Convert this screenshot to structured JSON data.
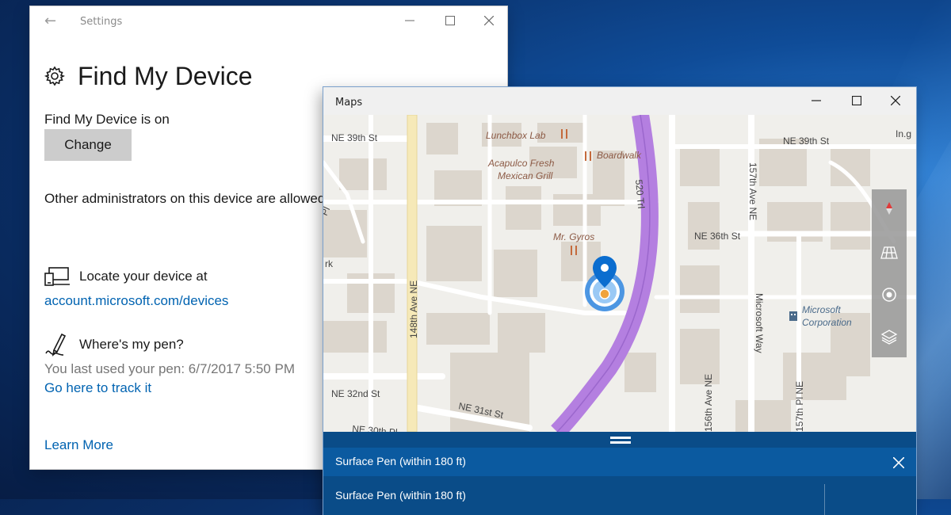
{
  "settings": {
    "back_glyph": "←",
    "app_title": "Settings",
    "page_title": "Find My Device",
    "status_text": "Find My Device is on",
    "change_button": "Change",
    "admin_text": "Other administrators on this device are allowed to change these settings",
    "locate_label": "Locate your device at",
    "locate_link": "account.microsoft.com/devices",
    "pen_label": "Where's my pen?",
    "pen_last_used": "You last used your pen: 6/7/2017 5:50 PM",
    "pen_track_link": "Go here to track it",
    "learn_more": "Learn More"
  },
  "maps": {
    "title": "Maps",
    "streets": [
      "NE 39th St",
      "NE 39th St",
      "157th Ave NE",
      "148th Ave NE",
      "520 Trl",
      "NE 36th St",
      "Microsoft Way",
      "NE 32nd St",
      "NE 31st St",
      "NE 30th Pl",
      "156th Ave NE",
      "157th Pl NE",
      "157th Pl",
      "In.g",
      "Pl",
      "rk"
    ],
    "places": [
      "Lunchbox Lab",
      "Boardwalk",
      "Acapulco Fresh",
      "Mexican Grill",
      "Mr. Gyros",
      "Microsoft",
      "Corporation"
    ],
    "result_panel": {
      "device_name": "Surface Pen (within 180 ft)",
      "device_name_2": "Surface Pen (within 180 ft)"
    }
  },
  "icons": {
    "window_controls": [
      "minimize-icon",
      "maximize-icon",
      "close-icon"
    ],
    "settings_page": "gear-icon",
    "locate": "laptop-locate-icon",
    "pen": "pen-icon",
    "map_controls": [
      "compass-icon",
      "3d-view-icon",
      "locate-me-icon",
      "layers-icon"
    ],
    "pin": "location-pin-icon",
    "company": "building-icon",
    "restaurant": "restaurant-icon"
  },
  "colors": {
    "link": "#0063b1",
    "route": "#b47fe0",
    "panel": "#0a4c88",
    "panel_bar": "#0b5aa0",
    "pin_blue": "#0b6dcf",
    "desktop": "#0f4c98"
  }
}
